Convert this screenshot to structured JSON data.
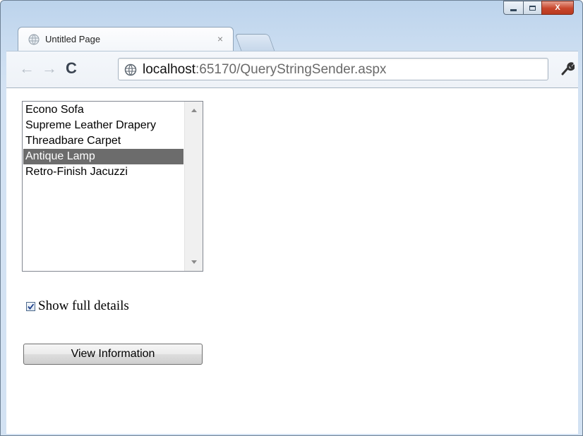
{
  "window": {
    "controls": {
      "minimize": "minimize",
      "maximize": "maximize",
      "close": "X"
    }
  },
  "tab": {
    "title": "Untitled Page",
    "close_glyph": "×",
    "favicon": "globe-icon"
  },
  "toolbar": {
    "back_glyph": "←",
    "forward_glyph": "→",
    "reload_glyph": "C",
    "url_host": "localhost",
    "url_rest": ":65170/QueryStringSender.aspx",
    "menu_icon": "wrench-icon"
  },
  "listbox": {
    "items": [
      {
        "label": "Econo Sofa",
        "selected": false
      },
      {
        "label": "Supreme Leather Drapery",
        "selected": false
      },
      {
        "label": "Threadbare Carpet",
        "selected": false
      },
      {
        "label": "Antique Lamp",
        "selected": true
      },
      {
        "label": "Retro-Finish Jacuzzi",
        "selected": false
      }
    ]
  },
  "checkbox": {
    "label": "Show full details",
    "checked": true
  },
  "button": {
    "label": "View Information"
  },
  "colors": {
    "selection": "#6c6c6c",
    "close_button": "#c8462c"
  }
}
